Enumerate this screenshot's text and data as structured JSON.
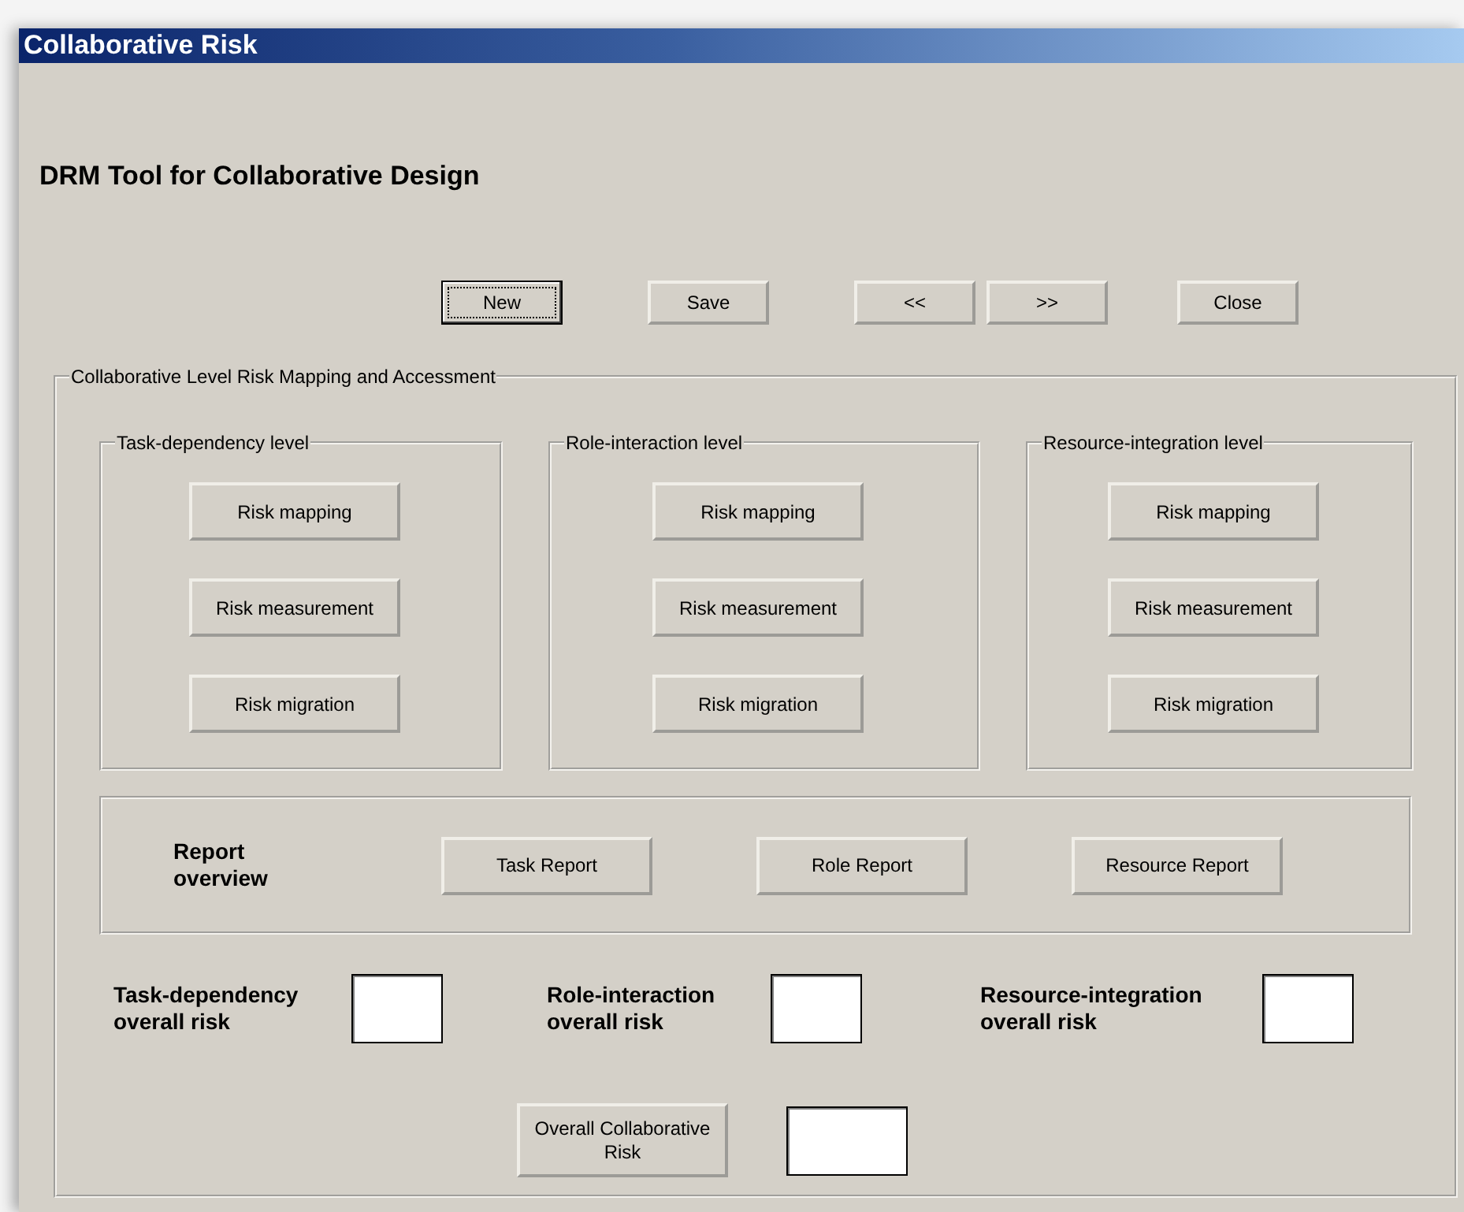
{
  "window": {
    "title": "Collaborative Risk"
  },
  "heading": "DRM Tool for Collaborative Design",
  "toolbar": [
    {
      "label": "New",
      "focused": true
    },
    {
      "label": "Save",
      "focused": false
    },
    {
      "label": "<<",
      "focused": false
    },
    {
      "label": ">>",
      "focused": false
    },
    {
      "label": "Close",
      "focused": false
    }
  ],
  "main_group": {
    "title": "Collaborative Level Risk Mapping and Accessment",
    "levels": [
      {
        "title": "Task-dependency level",
        "buttons": [
          "Risk mapping",
          "Risk measurement",
          "Risk migration"
        ]
      },
      {
        "title": "Role-interaction level",
        "buttons": [
          "Risk mapping",
          "Risk measurement",
          "Risk migration"
        ]
      },
      {
        "title": "Resource-integration level",
        "buttons": [
          "Risk mapping",
          "Risk measurement",
          "Risk migration"
        ]
      }
    ],
    "report": {
      "label": "Report overview",
      "buttons": [
        "Task Report",
        "Role Report",
        "Resource Report"
      ]
    },
    "overall_risks": [
      {
        "label": "Task-dependency overall risk"
      },
      {
        "label": "Role-interaction overall risk"
      },
      {
        "label": "Resource-integration overall risk"
      }
    ],
    "overall_button": "Overall Collaborative Risk"
  }
}
